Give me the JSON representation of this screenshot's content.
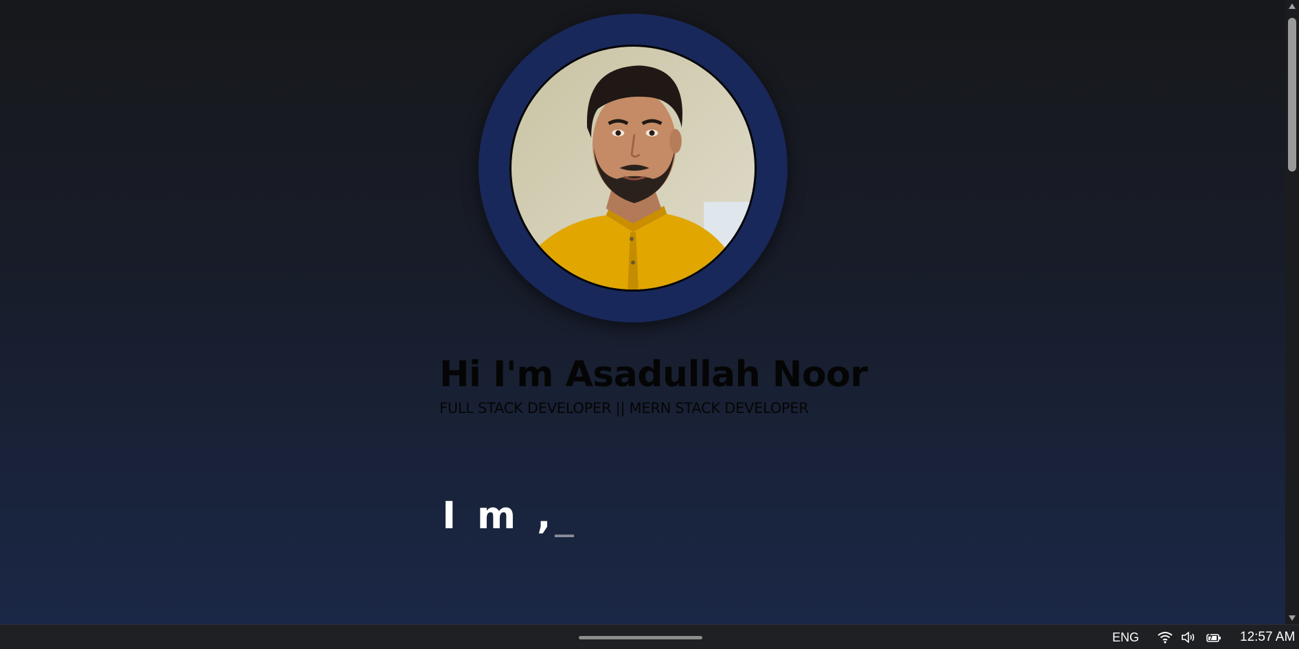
{
  "hero": {
    "title": "Hi I'm Asadullah Noor",
    "subtitle": "FULL STACK DEVELOPER || MERN STACK DEVELOPER",
    "typing_text": "I m ,",
    "typing_cursor": "_"
  },
  "avatar": {
    "icon": "profile-photo",
    "ring_color": "#19285a"
  },
  "taskbar": {
    "language": "ENG",
    "time": "12:57 AM",
    "icons": [
      "wifi-icon",
      "volume-icon",
      "battery-icon"
    ]
  },
  "colors": {
    "background_top": "#17181b",
    "background_bottom": "#1a2848",
    "title_text": "#050505",
    "typing_text": "#ffffff"
  }
}
